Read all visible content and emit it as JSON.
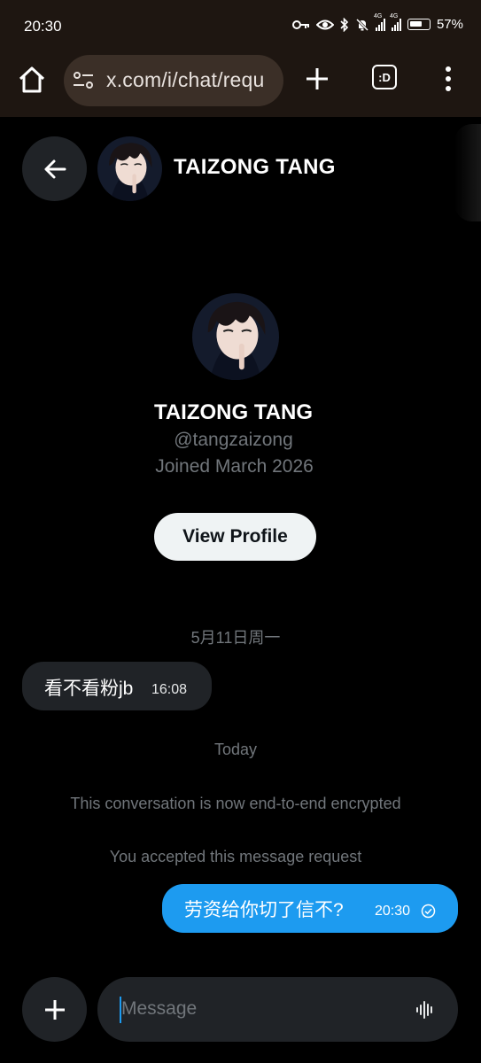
{
  "status_bar": {
    "time": "20:30",
    "network_label_1": "4G",
    "network_label_2": "4G",
    "battery": "57%",
    "icons": [
      "key-icon",
      "eye-icon",
      "bluetooth-icon",
      "mute-icon",
      "signal-icon",
      "signal-icon",
      "battery-icon"
    ]
  },
  "browser": {
    "url": "x.com/i/chat/requ",
    "tabs_label": ":D"
  },
  "chat_header": {
    "name": "TAIZONG TANG"
  },
  "profile": {
    "name": "TAIZONG TANG",
    "handle": "@tangzaizong",
    "joined": "Joined March 2026",
    "view_profile_label": "View Profile"
  },
  "messages": {
    "date_1": "5月11日周一",
    "incoming": {
      "text": "看不看粉jb",
      "time": "16:08"
    },
    "date_2": "Today",
    "system_1": "This conversation is now end-to-end encrypted",
    "system_2": "You accepted this message request",
    "outgoing": {
      "text": "劳资给你切了信不?",
      "time": "20:30"
    }
  },
  "composer": {
    "placeholder": "Message"
  },
  "colors": {
    "accent": "#1d9bf0",
    "surface": "#202327",
    "muted_text": "#71767b",
    "browser_bar": "#1e1611"
  }
}
